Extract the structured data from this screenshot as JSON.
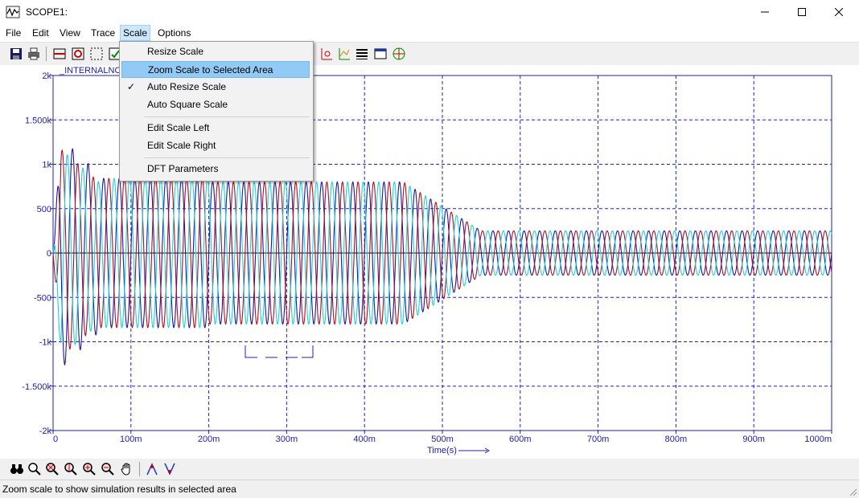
{
  "window": {
    "title": "SCOPE1:",
    "icon": "scope-app-icon"
  },
  "window_controls": {
    "minimize": "minimize-icon",
    "maximize": "maximize-icon",
    "close": "close-icon"
  },
  "menubar": {
    "items": [
      {
        "label": "File",
        "name": "menu-file"
      },
      {
        "label": "Edit",
        "name": "menu-edit"
      },
      {
        "label": "View",
        "name": "menu-view"
      },
      {
        "label": "Trace",
        "name": "menu-trace"
      },
      {
        "label": "Scale",
        "name": "menu-scale",
        "active": true
      },
      {
        "label": "Options",
        "name": "menu-options"
      }
    ]
  },
  "scale_menu": {
    "items": [
      {
        "label": "Resize Scale",
        "checked": false,
        "highlighted": false
      },
      {
        "label": "Zoom Scale to Selected Area",
        "checked": false,
        "highlighted": true
      },
      {
        "label": "Auto Resize Scale",
        "checked": true,
        "highlighted": false
      },
      {
        "label": "Auto Square Scale",
        "checked": false,
        "highlighted": false
      },
      {
        "label": "Edit Scale Left",
        "checked": false,
        "highlighted": false
      },
      {
        "label": "Edit Scale Right",
        "checked": false,
        "highlighted": false
      },
      {
        "label": "DFT Parameters",
        "checked": false,
        "highlighted": false
      }
    ]
  },
  "plot": {
    "trace_label": "_INTERNALNODE",
    "y_ticks": [
      "2k",
      "1.500k",
      "1k",
      "500",
      "0",
      "-500",
      "-1k",
      "-1.500k",
      "-2k"
    ],
    "x_ticks": [
      "0",
      "100m",
      "200m",
      "300m",
      "400m",
      "500m",
      "600m",
      "700m",
      "800m",
      "900m",
      "1000m"
    ],
    "x_label": "Time(s)",
    "colors": {
      "axis": "#2020b0",
      "grid": "#2020d0",
      "trace1": "#1a1aa0",
      "trace2": "#b01020",
      "trace3": "#20d0d8"
    }
  },
  "chart_data": {
    "type": "line",
    "title": "",
    "xlabel": "Time(s)",
    "ylabel": "",
    "xlim": [
      0,
      1
    ],
    "ylim": [
      -2000,
      2000
    ],
    "grid": true,
    "series": [
      {
        "name": "_INTERNALNODE",
        "color": "#1a1aa0"
      },
      {
        "color": "#b01020"
      },
      {
        "color": "#20d0d8"
      }
    ],
    "signal": {
      "frequency_hz": 50,
      "initial_peak": 1300,
      "pre_disturbance_amplitude": 800,
      "disturbance_end_s": 0.55,
      "steady_amplitude": 250
    }
  },
  "bottom_toolbar": {
    "icons": [
      "binoculars-icon",
      "zoom-icon",
      "zoom-out-x-icon",
      "zoom-y-icon",
      "zoom-in-icon",
      "zoom-out-icon",
      "pan-hand-icon",
      "cursor-a-icon",
      "cursor-b-icon"
    ]
  },
  "status": {
    "text": "Zoom scale to show simulation results in selected area"
  }
}
